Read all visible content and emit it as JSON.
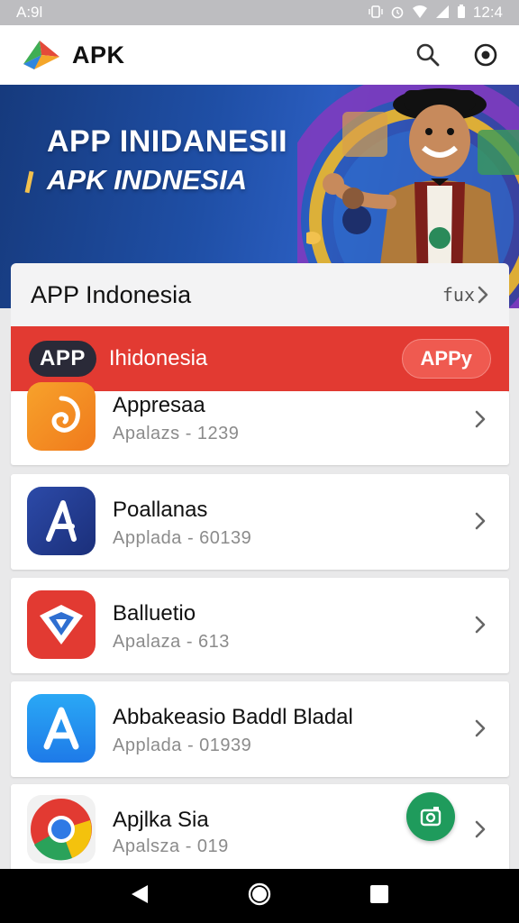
{
  "status_bar": {
    "time_left": "A:9l",
    "time_right": "12:4",
    "icons": [
      "vibrate-icon",
      "alarm-icon",
      "wifi-icon",
      "signal-icon",
      "battery-icon"
    ]
  },
  "app_bar": {
    "title": "APK",
    "actions": [
      "search-icon",
      "info-circle-icon"
    ]
  },
  "banner": {
    "line1": "APP INIDANESII",
    "line2": "APK INDNESIA"
  },
  "section": {
    "title": "APP Indonesia",
    "more_label": "fux"
  },
  "promo": {
    "pill": "APP",
    "label": "Ihidonesia",
    "button": "APPy"
  },
  "apps": [
    {
      "name": "Appresaa",
      "meta": "Apalazs  -  1239",
      "icon": "spiral-app-icon"
    },
    {
      "name": "Poallanas",
      "meta": "Applada  -  60139",
      "icon": "letter-a-app-icon"
    },
    {
      "name": "Balluetio",
      "meta": "Apalaza  -  613",
      "icon": "shield-app-icon"
    },
    {
      "name": "Abbakeasio Baddl Bladal",
      "meta": "Applada  -  01939",
      "icon": "app-store-icon"
    },
    {
      "name": "Apjlka Sia",
      "meta": "Apalsza  -  019",
      "icon": "chrome-icon"
    }
  ],
  "colors": {
    "promo_red": "#e23a32",
    "banner_blue": "#1f4fa6",
    "fab_green": "#1f9b5c"
  },
  "nav": [
    "back-icon",
    "home-icon",
    "recents-icon"
  ]
}
